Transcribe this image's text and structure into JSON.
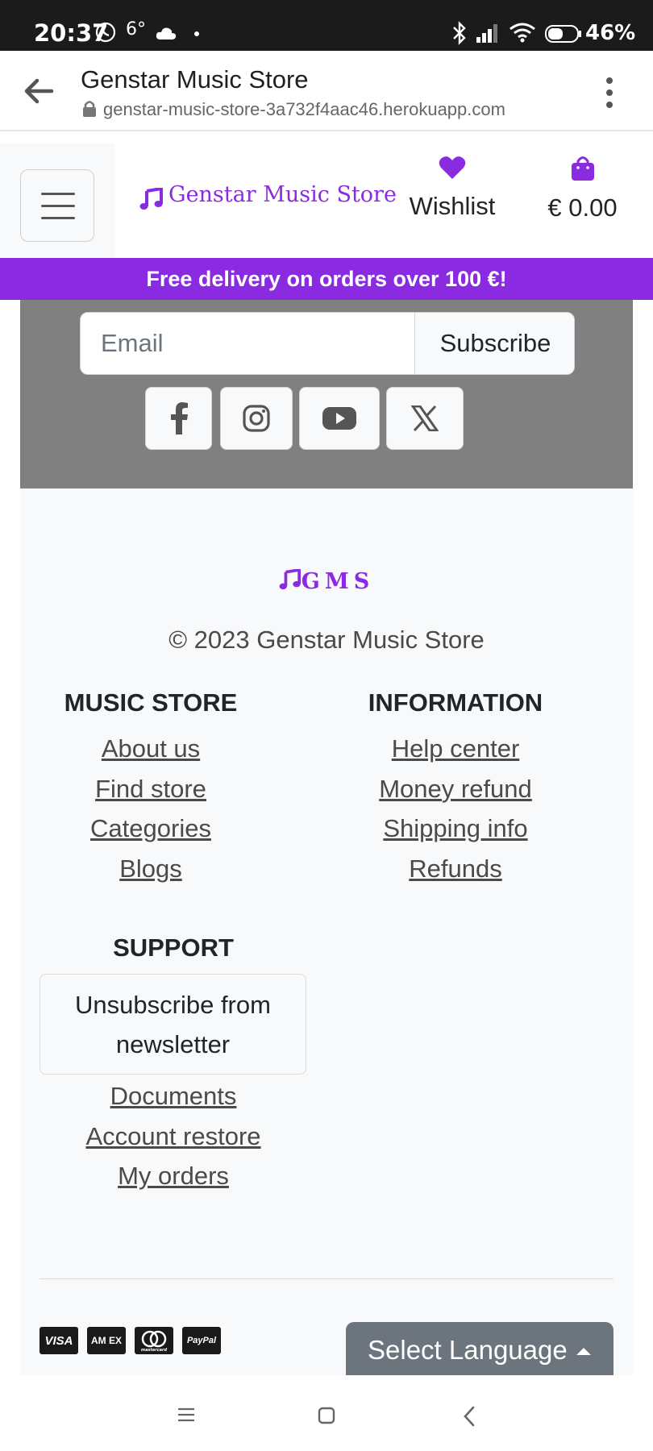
{
  "status_bar": {
    "time": "20:37",
    "temperature": "6°",
    "battery": "46%"
  },
  "browser": {
    "title": "Genstar Music Store",
    "url": "genstar-music-store-3a732f4aac46.herokuapp.com"
  },
  "navbar": {
    "brand": "Genstar Music Store",
    "wishlist_label": "Wishlist",
    "cart_total": "€ 0.00"
  },
  "promo": {
    "text": "Free delivery on orders over 100 €!"
  },
  "newsletter": {
    "email_placeholder": "Email",
    "subscribe_label": "Subscribe"
  },
  "social": [
    "facebook-icon",
    "instagram-icon",
    "youtube-icon",
    "x-icon"
  ],
  "footer": {
    "logo": "GMS",
    "copyright": "© 2023 Genstar Music Store",
    "music_store": {
      "heading": "MUSIC STORE",
      "links": [
        "About us",
        "Find store",
        "Categories",
        "Blogs"
      ]
    },
    "information": {
      "heading": "INFORMATION",
      "links": [
        "Help center",
        "Money refund",
        "Shipping info",
        "Refunds"
      ]
    },
    "support": {
      "heading": "SUPPORT",
      "unsubscribe_label": "Unsubscribe from newsletter",
      "links": [
        "Documents",
        "Account restore",
        "My orders"
      ]
    },
    "payments": {
      "visa": "VISA",
      "amex": "AM EX",
      "mastercard": "mastercard",
      "paypal": "PayPal"
    },
    "language_label": "Select Language"
  },
  "colors": {
    "brand": "#8a2be2",
    "newsletter_bg": "#808080",
    "footer_bg": "#f8f9fa",
    "language_bg": "#6c757d"
  }
}
